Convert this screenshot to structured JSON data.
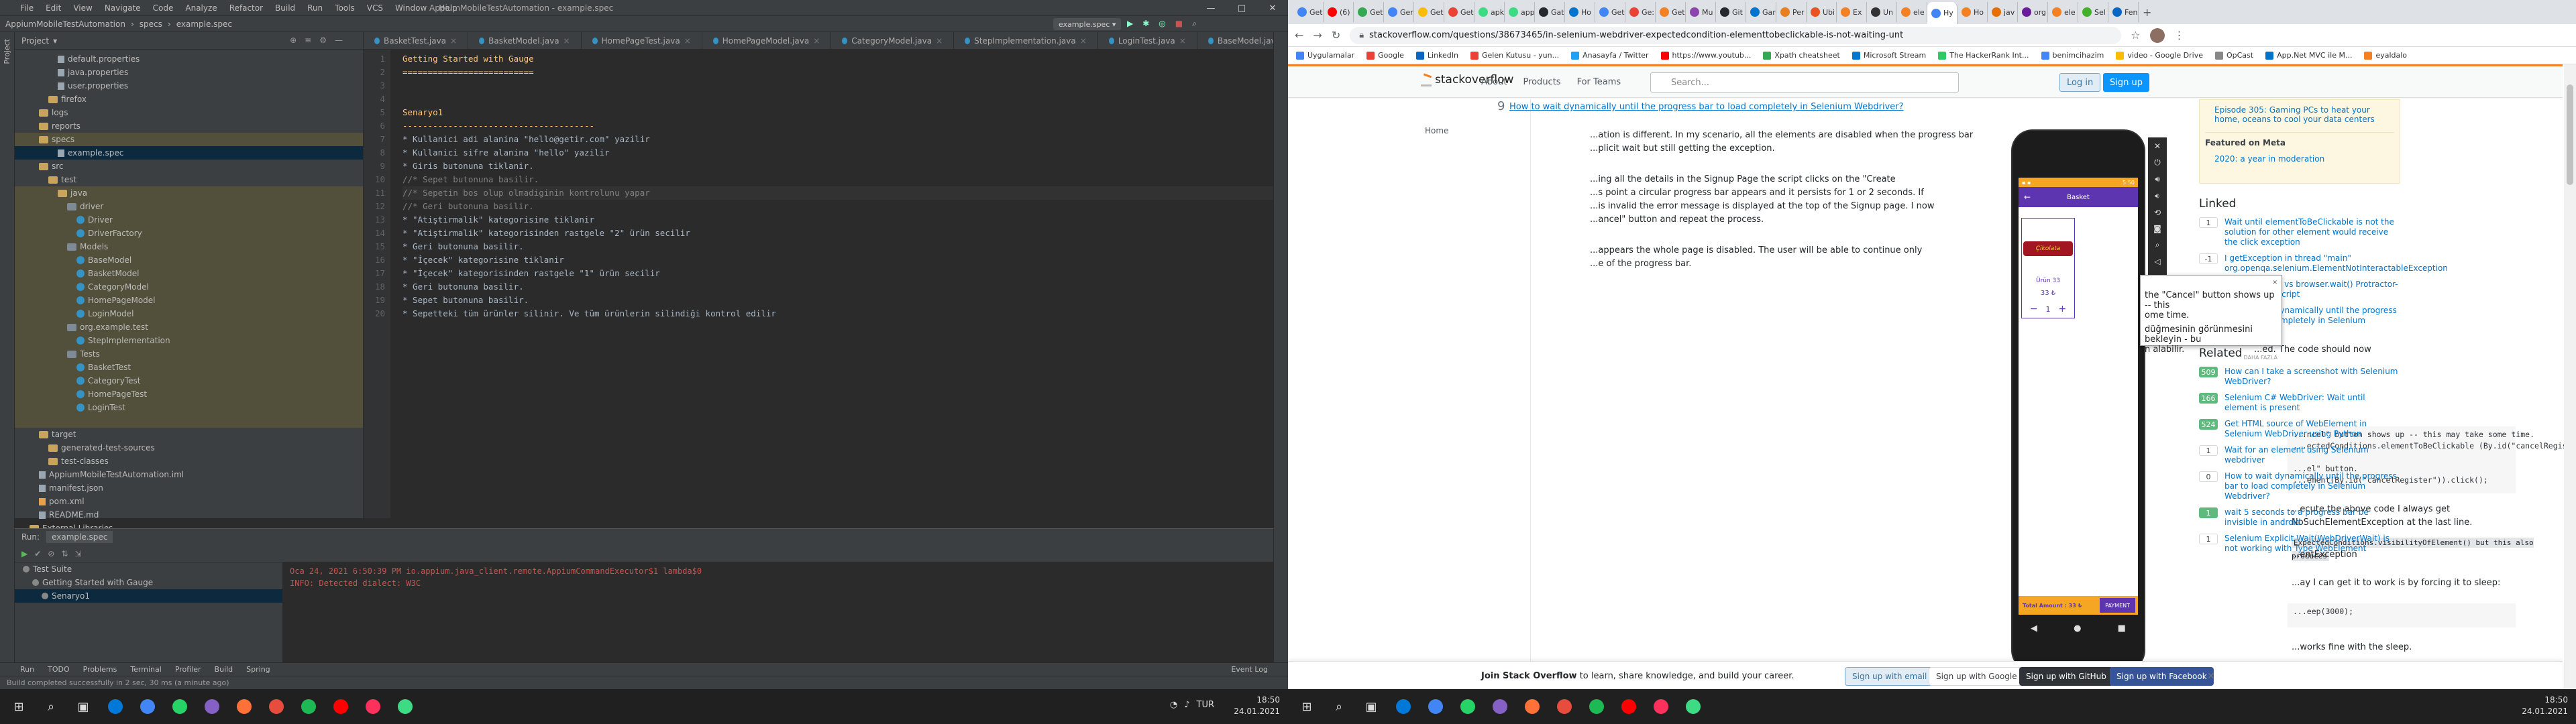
{
  "ide": {
    "menu": [
      "File",
      "Edit",
      "View",
      "Navigate",
      "Code",
      "Analyze",
      "Refactor",
      "Build",
      "Run",
      "Tools",
      "VCS",
      "Window",
      "Help"
    ],
    "window_title": "AppiumMobileTestAutomation - example.spec",
    "breadcrumb": [
      "AppiumMobileTestAutomation",
      "specs",
      "example.spec"
    ],
    "run_config": "example.spec",
    "project_label": "Project",
    "tree": [
      {
        "label": "default.properties",
        "indent": 4,
        "icon": "file",
        "hl": ""
      },
      {
        "label": "java.properties",
        "indent": 4,
        "icon": "file",
        "hl": ""
      },
      {
        "label": "user.properties",
        "indent": 4,
        "icon": "file",
        "hl": ""
      },
      {
        "label": "firefox",
        "indent": 3,
        "icon": "folder",
        "hl": ""
      },
      {
        "label": "logs",
        "indent": 2,
        "icon": "folder",
        "hl": ""
      },
      {
        "label": "reports",
        "indent": 2,
        "icon": "folder",
        "hl": ""
      },
      {
        "label": "specs",
        "indent": 2,
        "icon": "folder",
        "hl": "yel"
      },
      {
        "label": "example.spec",
        "indent": 4,
        "icon": "file",
        "hl": "sel"
      },
      {
        "label": "src",
        "indent": 2,
        "icon": "folder",
        "hl": ""
      },
      {
        "label": "test",
        "indent": 3,
        "icon": "folder",
        "hl": ""
      },
      {
        "label": "java",
        "indent": 4,
        "icon": "folder",
        "hl": "yel"
      },
      {
        "label": "driver",
        "indent": 5,
        "icon": "pkg",
        "hl": "yel"
      },
      {
        "label": "Driver",
        "indent": 6,
        "icon": "cls",
        "hl": "yel"
      },
      {
        "label": "DriverFactory",
        "indent": 6,
        "icon": "cls",
        "hl": "yel"
      },
      {
        "label": "Models",
        "indent": 5,
        "icon": "pkg",
        "hl": "yel"
      },
      {
        "label": "BaseModel",
        "indent": 6,
        "icon": "cls",
        "hl": "yel"
      },
      {
        "label": "BasketModel",
        "indent": 6,
        "icon": "cls",
        "hl": "yel"
      },
      {
        "label": "CategoryModel",
        "indent": 6,
        "icon": "cls",
        "hl": "yel"
      },
      {
        "label": "HomePageModel",
        "indent": 6,
        "icon": "cls",
        "hl": "yel"
      },
      {
        "label": "LoginModel",
        "indent": 6,
        "icon": "cls",
        "hl": "yel"
      },
      {
        "label": "org.example.test",
        "indent": 5,
        "icon": "pkg",
        "hl": "yel"
      },
      {
        "label": "StepImplementation",
        "indent": 6,
        "icon": "cls",
        "hl": "yel"
      },
      {
        "label": "Tests",
        "indent": 5,
        "icon": "pkg",
        "hl": "yel"
      },
      {
        "label": "BasketTest",
        "indent": 6,
        "icon": "cls",
        "hl": "yel"
      },
      {
        "label": "CategoryTest",
        "indent": 6,
        "icon": "cls",
        "hl": "yel"
      },
      {
        "label": "HomePageTest",
        "indent": 6,
        "icon": "cls",
        "hl": "yel"
      },
      {
        "label": "LoginTest",
        "indent": 6,
        "icon": "cls",
        "hl": "yel"
      },
      {
        "label": "",
        "indent": 0,
        "icon": "",
        "hl": "yel"
      },
      {
        "label": "target",
        "indent": 2,
        "icon": "folder",
        "hl": ""
      },
      {
        "label": "generated-test-sources",
        "indent": 3,
        "icon": "folder",
        "hl": ""
      },
      {
        "label": "test-classes",
        "indent": 3,
        "icon": "folder",
        "hl": ""
      },
      {
        "label": "AppiumMobileTestAutomation.iml",
        "indent": 2,
        "icon": "file",
        "hl": ""
      },
      {
        "label": "manifest.json",
        "indent": 2,
        "icon": "file",
        "hl": ""
      },
      {
        "label": "pom.xml",
        "indent": 2,
        "icon": "xml",
        "hl": ""
      },
      {
        "label": "README.md",
        "indent": 2,
        "icon": "file",
        "hl": ""
      },
      {
        "label": "External Libraries",
        "indent": 1,
        "icon": "folder",
        "hl": ""
      }
    ],
    "tabs": [
      "BasketTest.java",
      "BasketModel.java",
      "HomePageTest.java",
      "HomePageModel.java",
      "CategoryModel.java",
      "StepImplementation.java",
      "LoginTest.java",
      "BaseModel.java",
      "example.spec"
    ],
    "code_lines": [
      {
        "t": "Getting Started with Gauge",
        "c": "c-h"
      },
      {
        "t": "==========================",
        "c": "c-h"
      },
      {
        "t": "",
        "c": ""
      },
      {
        "t": "",
        "c": ""
      },
      {
        "t": "Senaryo1",
        "c": "c-h"
      },
      {
        "t": "--------------------------------------",
        "c": "c-h"
      },
      {
        "t": "* Kullanici adi alanina \"hello@getir.com\" yazilir",
        "c": ""
      },
      {
        "t": "* Kullanici sifre alanina \"hello\" yazilir",
        "c": ""
      },
      {
        "t": "* Giris butonuna tiklanir.",
        "c": ""
      },
      {
        "t": "//* Sepet butonuna basilir.",
        "c": "c-cm"
      },
      {
        "t": "//* Sepetin bos olup olmadiginin kontrolunu yapar",
        "c": "c-cm"
      },
      {
        "t": "//* Geri butonuna basilir.",
        "c": "c-cm"
      },
      {
        "t": "* \"Atiştirmalik\" kategorisine tiklanir",
        "c": ""
      },
      {
        "t": "* \"Atiştirmalik\" kategorisinden rastgele \"2\" ürün secilir",
        "c": ""
      },
      {
        "t": "* Geri butonuna basilir.",
        "c": ""
      },
      {
        "t": "* \"İçecek\" kategorisine tiklanir",
        "c": ""
      },
      {
        "t": "* \"İçecek\" kategorisinden rastgele \"1\" ürün secilir",
        "c": ""
      },
      {
        "t": "* Geri butonuna basilir.",
        "c": ""
      },
      {
        "t": "* Sepet butonuna basilir.",
        "c": ""
      },
      {
        "t": "* Sepetteki tüm ürünler silinir. Ve tüm ürünlerin silindiği kontrol edilir",
        "c": ""
      }
    ],
    "run": {
      "label": "Run:",
      "config": "example.spec",
      "tree": [
        "Test Suite",
        "Getting Started with Gauge",
        "Senaryo1"
      ],
      "output": [
        "Oca 24, 2021 6:50:39 PM io.appium.java_client.remote.AppiumCommandExecutor$1 lambda$0",
        "INFO: Detected dialect: W3C"
      ]
    },
    "bottom_tools": [
      "Run",
      "TODO",
      "Problems",
      "Terminal",
      "Profiler",
      "Build",
      "Spring"
    ],
    "event_log": "Event Log",
    "status": "Build completed successfully in 2 sec, 30 ms (a minute ago)"
  },
  "browser": {
    "url": "stackoverflow.com/questions/38673465/in-selenium-webdriver-expectedcondition-elementtobeclickable-is-not-waiting-unt",
    "tabs": [
      "Get",
      "(6)",
      "Get",
      "Ger",
      "Get",
      "Get",
      "apk",
      "app",
      "Gat",
      "Ho",
      "Get",
      "Ge:",
      "Get",
      "Mu",
      "Git",
      "Gar",
      "Per",
      "Ubi",
      "Ex",
      "Un",
      "ele",
      "Hy",
      "Ho",
      "jav",
      "org",
      "ele",
      "Sel",
      "Fener"
    ],
    "bookmarks": [
      "Uygulamalar",
      "Google",
      "LinkedIn",
      "Gelen Kutusu - yun...",
      "Anasayfa / Twitter",
      "https://www.youtub...",
      "Xpath cheatsheet",
      "Microsoft Stream",
      "The HackerRank Int...",
      "benimcihazim",
      "video - Google Drive",
      "OpCast",
      "App.Net MVC ile M...",
      "eyaldalo"
    ],
    "so": {
      "logo": "stackoverflow",
      "nav": [
        "About",
        "Products",
        "For Teams"
      ],
      "search_placeholder": "Search...",
      "login": "Log in",
      "signup": "Sign up",
      "left_nav": "Home",
      "vote": "9",
      "question_link": "How to wait dynamically until the progress bar to load completely in Selenium Webdriver?",
      "paragraphs": [
        "...ation is different. In my scenario, all the elements are disabled when the progress bar",
        "...plicit wait but still getting the exception.",
        "...ing all the details in the Signup Page the script clicks on the \"Create",
        "...s point a circular progress bar appears and it persists for 1 or 2 seconds. If",
        "...is invalid the error message is displayed at the top of the Signup page. I now",
        "...ancel\" button and repeat the process.",
        "...appears the whole page is disabled. The user will be able to continue only",
        "...e of the progress bar.",
        "...ed. The code should now"
      ],
      "code1": "...ncel\" button shows up -- this may take some time.\n...ectedConditions.elementToBeClickable (By.id(\"cancelRegister\")));\n\n...el\" button.\n...ement(By.id(\"cancelRegister\")).click();",
      "p2": "...ecute the above code I always get NoSuchElementException at the last line.",
      "p3": "ExpectedConditions.visibilityOfElement() but this also produces",
      "p4": "...entException",
      "p5": "...ay I can get it to work is by forcing it to sleep:",
      "code2": "...eep(3000);",
      "p6": "...works fine with the sleep.",
      "blog": [
        "Episode 305: Gaming PCs to heat your home, oceans to cool your data centers",
        "Featured on Meta",
        "2020: a year in moderation"
      ],
      "linked_title": "Linked",
      "linked": [
        {
          "v": "1",
          "t": "Wait until elementToBeClickable is not the solution for other element would receive the click exception",
          "g": false
        },
        {
          "v": "-1",
          "t": "I getException in thread \"main\" org.openqa.selenium.ElementNotInteractableException",
          "g": false
        },
        {
          "v": "0",
          "t": "browser.wait() vs browser.wait() Protractor-Jasmine-JavaScript",
          "g": false
        },
        {
          "v": "0",
          "t": "How to wait dynamically until the progress bar to load completely in Selenium Webdriver?",
          "g": false
        }
      ],
      "related_title": "Related",
      "related": [
        {
          "v": "509",
          "t": "How can I take a screenshot with Selenium WebDriver?",
          "g": true
        },
        {
          "v": "166",
          "t": "Selenium C# WebDriver: Wait until element is present",
          "g": true
        },
        {
          "v": "524",
          "t": "Get HTML source of WebElement in Selenium WebDriver using Python",
          "g": true
        },
        {
          "v": "1",
          "t": "Wait for an element using Selenium webdriver",
          "g": false
        },
        {
          "v": "0",
          "t": "How to wait dynamically until the progress bar to load completely in Selenium Webdriver?",
          "g": false
        },
        {
          "v": "1",
          "t": "wait 5 seconds to a progress bar be invisible in android",
          "g": true
        },
        {
          "v": "1",
          "t": "Selenium Explicit Wait(WebDriverWait) is not working with Type WebElement",
          "g": false
        }
      ],
      "join_text": "Join Stack Overflow to learn, share knowledge, and build your career.",
      "join_bold": "Join Stack Overflow",
      "join_rest": " to learn, share knowledge, and build your career.",
      "join_email": "Sign up with email",
      "join_google": "Sign up with Google",
      "join_github": "Sign up with GitHub",
      "join_facebook": "Sign up with Facebook"
    },
    "popup": {
      "line1": "the \"Cancel\" button shows up -- this",
      "line2": "ome time.",
      "line3": "düğmesinin görünmesini bekleyin - bu",
      "line4": "n alabilir.",
      "more": "DAHA FAZLA"
    }
  },
  "phone": {
    "time": "5:50",
    "title": "Basket",
    "product_brand": "Çikolata",
    "product_name": "Ürün 33",
    "price": "33 ₺",
    "qty": "1",
    "total": "Total Amount : 33 ₺",
    "pay": "PAYMENT"
  },
  "taskbar": {
    "time_left": "18:50",
    "date_left": "24.01.2021",
    "time_right": "18:50",
    "date_right": "24.01.2021",
    "lang": "TUR"
  },
  "colors": {
    "ide_bg": "#2b2b2b",
    "so_orange": "#f48024",
    "phone_purple": "#5e35b1",
    "phone_orange": "#f5a623"
  }
}
